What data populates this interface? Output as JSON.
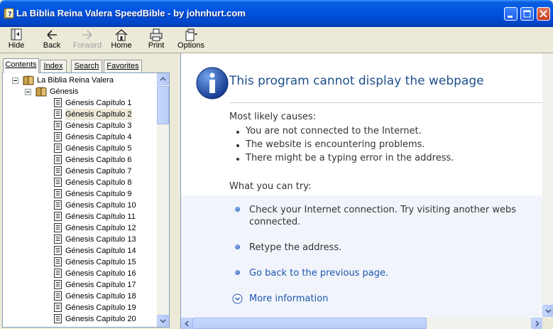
{
  "window": {
    "title": "La Biblia Reina Valera SpeedBible - by johnhurt.com",
    "controls": [
      "minimize",
      "maximize",
      "close"
    ]
  },
  "toolbar": {
    "buttons": [
      {
        "label": "Hide",
        "icon": "hide-icon"
      },
      {
        "label": "Back",
        "icon": "back-arrow-icon"
      },
      {
        "label": "Forward",
        "icon": "forward-arrow-icon",
        "disabled": true
      },
      {
        "label": "Home",
        "icon": "home-icon"
      },
      {
        "label": "Print",
        "icon": "printer-icon"
      },
      {
        "label": "Options",
        "icon": "options-icon"
      }
    ]
  },
  "nav": {
    "tabs": [
      "Contents",
      "Index",
      "Search",
      "Favorites"
    ],
    "active_tab": "Contents",
    "tree": {
      "root": "La Biblia Reina Valera",
      "book": "Génesis",
      "selected": "Génesis Capítulo 2",
      "chapters": [
        "Génesis Capítulo 1",
        "Génesis Capítulo 2",
        "Génesis Capítulo 3",
        "Génesis Capítulo 4",
        "Génesis Capítulo 5",
        "Génesis Capítulo 6",
        "Génesis Capítulo 7",
        "Génesis Capítulo 8",
        "Génesis Capítulo 9",
        "Génesis Capítulo 10",
        "Génesis Capítulo 11",
        "Génesis Capítulo 12",
        "Génesis Capítulo 13",
        "Génesis Capítulo 14",
        "Génesis Capítulo 15",
        "Génesis Capítulo 16",
        "Génesis Capítulo 17",
        "Génesis Capítulo 18",
        "Génesis Capítulo 19",
        "Génesis Capítulo 20"
      ]
    }
  },
  "content": {
    "title": "This program cannot display the webpage",
    "causes_heading": "Most likely causes:",
    "causes": [
      "You are not connected to the Internet.",
      "The website is encountering problems.",
      "There might be a typing error in the address."
    ],
    "try_heading": "What you can try:",
    "try_items": [
      {
        "line1": "Check your Internet connection. Try visiting another webs",
        "line2": "connected."
      },
      {
        "line1": "Retype the address."
      },
      {
        "line1": "Go back to the previous page.",
        "link": true
      }
    ],
    "more_info": "More information"
  },
  "colors": {
    "titlebar": "#0054e3",
    "heading": "#1f4f8c",
    "link": "#1d56b0"
  }
}
